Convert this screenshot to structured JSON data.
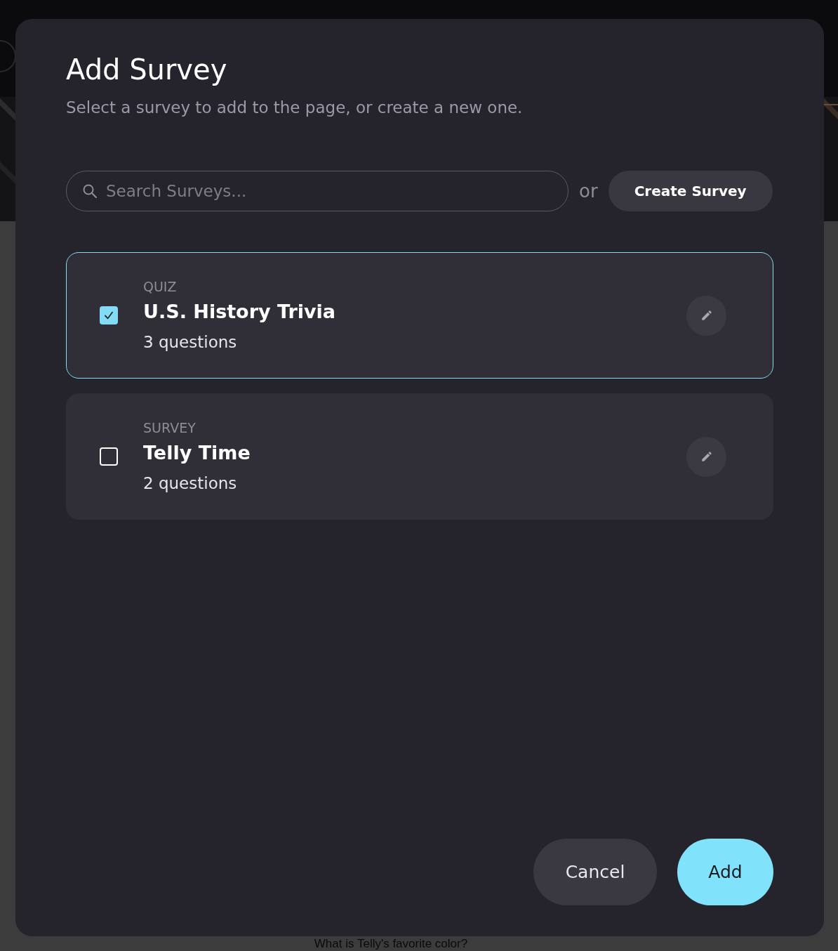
{
  "background": {
    "question": "What is Telly's favorite color?"
  },
  "dialog": {
    "title": "Add Survey",
    "subtitle": "Select a survey to add to the page, or create a new one.",
    "search": {
      "placeholder": "Search Surveys..."
    },
    "or_label": "or",
    "create_button": "Create Survey",
    "surveys": [
      {
        "category": "QUIZ",
        "title": "U.S. History Trivia",
        "questions": "3 questions",
        "checked": true
      },
      {
        "category": "SURVEY",
        "title": "Telly Time",
        "questions": "2 questions",
        "checked": false
      }
    ],
    "buttons": [
      {
        "kind": "secondary",
        "label": "Cancel"
      },
      {
        "kind": "primary",
        "label": "Add"
      }
    ]
  }
}
